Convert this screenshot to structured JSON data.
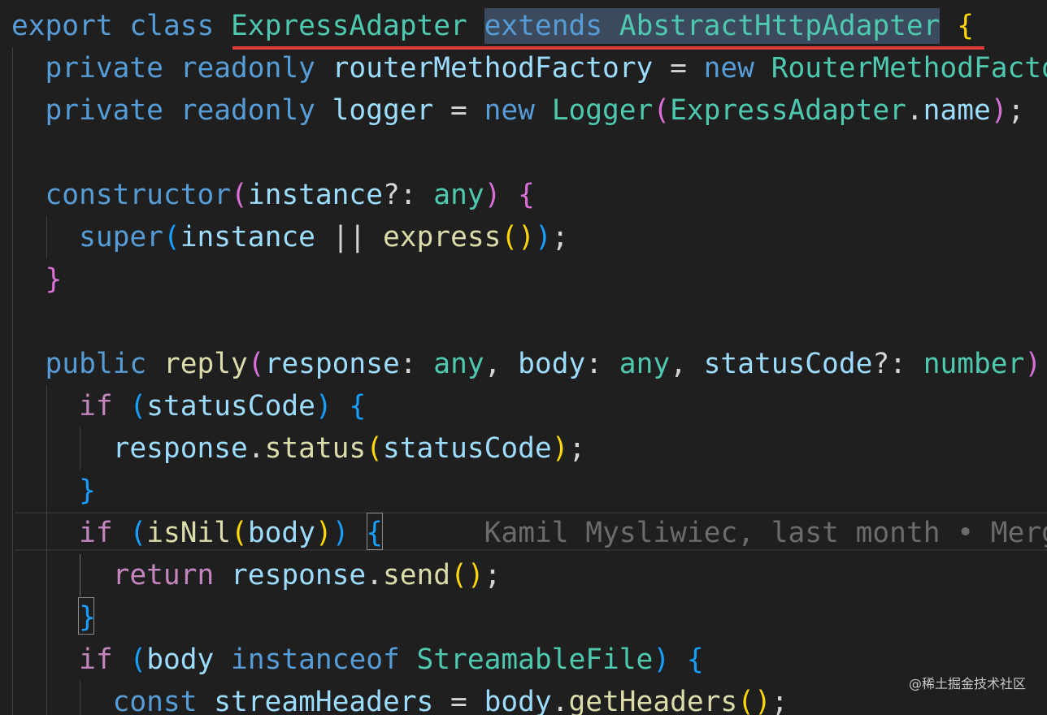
{
  "colors": {
    "background": "#1f1f1f",
    "keyword_blue": "#569cd6",
    "keyword_purple": "#c586c0",
    "type_teal": "#4ec9b0",
    "variable": "#9cdcfe",
    "function": "#dcdcaa",
    "bracket_gold": "#ffd700",
    "bracket_purple": "#da70d6",
    "bracket_blue": "#179fff",
    "plain": "#d4d4d4",
    "blame": "#6b6b6b",
    "underline": "#e03c3c"
  },
  "code_lines": [
    [
      {
        "t": "export ",
        "c": "kw"
      },
      {
        "t": "class ",
        "c": "kw"
      },
      {
        "t": "ExpressAdapter",
        "c": "ty"
      },
      {
        "t": " ",
        "c": "pl"
      },
      {
        "t": "extends",
        "c": "kw"
      },
      {
        "t": " ",
        "c": "pl"
      },
      {
        "t": "AbstractHttpAdapter",
        "c": "ty"
      },
      {
        "t": " ",
        "c": "pl"
      },
      {
        "t": "{",
        "c": "b1"
      }
    ],
    [
      {
        "t": "  private ",
        "c": "kw"
      },
      {
        "t": "readonly ",
        "c": "kw"
      },
      {
        "t": "routerMethodFactory",
        "c": "va"
      },
      {
        "t": " = ",
        "c": "pl"
      },
      {
        "t": "new ",
        "c": "kw"
      },
      {
        "t": "RouterMethodFacto",
        "c": "ty"
      }
    ],
    [
      {
        "t": "  private ",
        "c": "kw"
      },
      {
        "t": "readonly ",
        "c": "kw"
      },
      {
        "t": "logger",
        "c": "va"
      },
      {
        "t": " = ",
        "c": "pl"
      },
      {
        "t": "new ",
        "c": "kw"
      },
      {
        "t": "Logger",
        "c": "ty"
      },
      {
        "t": "(",
        "c": "b2"
      },
      {
        "t": "ExpressAdapter",
        "c": "ty"
      },
      {
        "t": ".",
        "c": "pl"
      },
      {
        "t": "name",
        "c": "va"
      },
      {
        "t": ")",
        "c": "b2"
      },
      {
        "t": ";",
        "c": "pl"
      }
    ],
    [],
    [
      {
        "t": "  constructor",
        "c": "kw"
      },
      {
        "t": "(",
        "c": "b2"
      },
      {
        "t": "instance",
        "c": "va"
      },
      {
        "t": "?: ",
        "c": "pl"
      },
      {
        "t": "any",
        "c": "ty"
      },
      {
        "t": ") ",
        "c": "b2"
      },
      {
        "t": "{",
        "c": "b2"
      }
    ],
    [
      {
        "t": "    super",
        "c": "kw"
      },
      {
        "t": "(",
        "c": "b3"
      },
      {
        "t": "instance",
        "c": "va"
      },
      {
        "t": " || ",
        "c": "pl"
      },
      {
        "t": "express",
        "c": "fn"
      },
      {
        "t": "()",
        "c": "b1"
      },
      {
        "t": ")",
        "c": "b3"
      },
      {
        "t": ";",
        "c": "pl"
      }
    ],
    [
      {
        "t": "  }",
        "c": "b2"
      }
    ],
    [],
    [
      {
        "t": "  public ",
        "c": "kw"
      },
      {
        "t": "reply",
        "c": "fn"
      },
      {
        "t": "(",
        "c": "b2"
      },
      {
        "t": "response",
        "c": "va"
      },
      {
        "t": ": ",
        "c": "pl"
      },
      {
        "t": "any",
        "c": "ty"
      },
      {
        "t": ", ",
        "c": "pl"
      },
      {
        "t": "body",
        "c": "va"
      },
      {
        "t": ": ",
        "c": "pl"
      },
      {
        "t": "any",
        "c": "ty"
      },
      {
        "t": ", ",
        "c": "pl"
      },
      {
        "t": "statusCode",
        "c": "va"
      },
      {
        "t": "?: ",
        "c": "pl"
      },
      {
        "t": "number",
        "c": "ty"
      },
      {
        "t": ")",
        "c": "b2"
      }
    ],
    [
      {
        "t": "    if ",
        "c": "kp"
      },
      {
        "t": "(",
        "c": "b3"
      },
      {
        "t": "statusCode",
        "c": "va"
      },
      {
        "t": ") ",
        "c": "b3"
      },
      {
        "t": "{",
        "c": "b3"
      }
    ],
    [
      {
        "t": "      response",
        "c": "va"
      },
      {
        "t": ".",
        "c": "pl"
      },
      {
        "t": "status",
        "c": "fn"
      },
      {
        "t": "(",
        "c": "b1"
      },
      {
        "t": "statusCode",
        "c": "va"
      },
      {
        "t": ")",
        "c": "b1"
      },
      {
        "t": ";",
        "c": "pl"
      }
    ],
    [
      {
        "t": "    }",
        "c": "b3"
      }
    ],
    [
      {
        "t": "    if ",
        "c": "kp"
      },
      {
        "t": "(",
        "c": "b3"
      },
      {
        "t": "isNil",
        "c": "fn"
      },
      {
        "t": "(",
        "c": "b1"
      },
      {
        "t": "body",
        "c": "va"
      },
      {
        "t": ")",
        "c": "b1"
      },
      {
        "t": ")",
        "c": "b3"
      },
      {
        "t": " ",
        "c": "pl"
      },
      {
        "t": "{",
        "c": "b3"
      },
      {
        "t": "      Kamil Mysliwiec, last month • Merg",
        "c": "bl"
      }
    ],
    [
      {
        "t": "      return ",
        "c": "kp"
      },
      {
        "t": "response",
        "c": "va"
      },
      {
        "t": ".",
        "c": "pl"
      },
      {
        "t": "send",
        "c": "fn"
      },
      {
        "t": "()",
        "c": "b1"
      },
      {
        "t": ";",
        "c": "pl"
      }
    ],
    [
      {
        "t": "    }",
        "c": "b3"
      }
    ],
    [
      {
        "t": "    if ",
        "c": "kp"
      },
      {
        "t": "(",
        "c": "b3"
      },
      {
        "t": "body ",
        "c": "va"
      },
      {
        "t": "instanceof ",
        "c": "kw"
      },
      {
        "t": "StreamableFile",
        "c": "ty"
      },
      {
        "t": ") ",
        "c": "b3"
      },
      {
        "t": "{",
        "c": "b3"
      }
    ],
    [
      {
        "t": "      const ",
        "c": "kw"
      },
      {
        "t": "streamHeaders",
        "c": "va"
      },
      {
        "t": " = ",
        "c": "pl"
      },
      {
        "t": "body",
        "c": "va"
      },
      {
        "t": ".",
        "c": "pl"
      },
      {
        "t": "getHeaders",
        "c": "fn"
      },
      {
        "t": "()",
        "c": "b1"
      },
      {
        "t": ";",
        "c": "pl"
      }
    ]
  ],
  "watermark": "@稀土掘金技术社区"
}
